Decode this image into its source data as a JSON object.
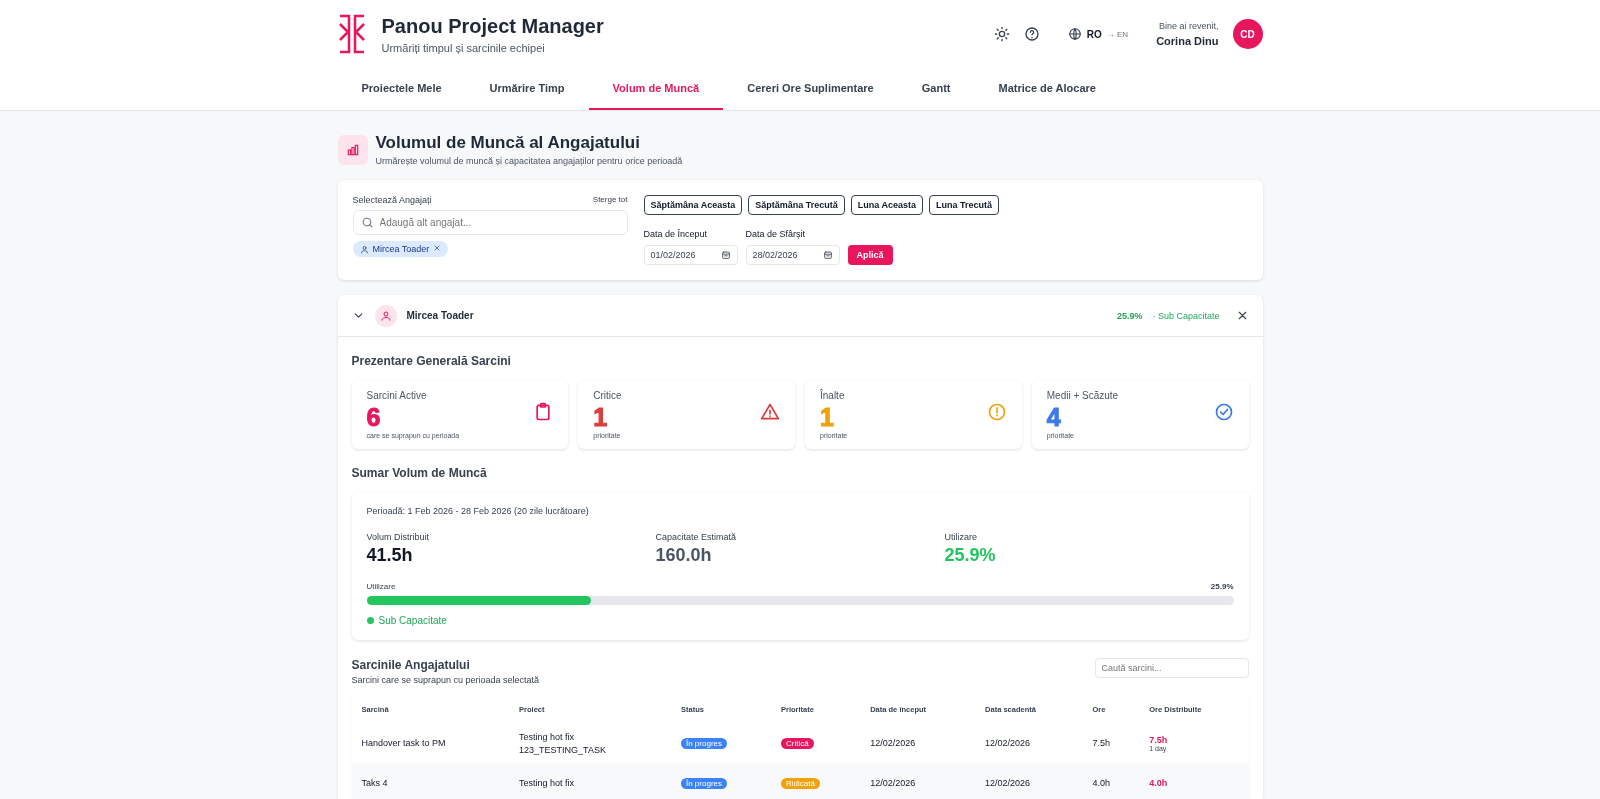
{
  "header": {
    "title": "Panou Project Manager",
    "subtitle": "Urmăriți timpul și sarcinile echipei",
    "languages": [
      {
        "label": "RO",
        "selected": true
      },
      {
        "label": "→ EN",
        "selected": false
      }
    ],
    "welcome": "Bine ai revenit,",
    "user_name": "Corina Dinu",
    "avatar_initials": "CD"
  },
  "tabs": [
    {
      "label": "Proiectele Mele",
      "selected": false
    },
    {
      "label": "Urmărire Timp",
      "selected": false
    },
    {
      "label": "Volum de Muncă",
      "selected": true
    },
    {
      "label": "Cereri Ore Suplimentare",
      "selected": false
    },
    {
      "label": "Gantt",
      "selected": false
    },
    {
      "label": "Matrice de Alocare",
      "selected": false
    }
  ],
  "page": {
    "title": "Volumul de Muncă al Angajatului",
    "subtitle": "Urmărește volumul de muncă și capacitatea angajaților pentru orice perioadă"
  },
  "filters": {
    "employees_label": "Selectează Angajați",
    "clear_all": "Șterge tot",
    "search_placeholder": "Adaugă alt angajat...",
    "chips": [
      "Mircea Toader"
    ],
    "presets": [
      "Săptămâna Aceasta",
      "Săptămâna Trecută",
      "Luna Aceasta",
      "Luna Trecută"
    ],
    "start_label": "Data de Început",
    "start_value": "01/02/2026",
    "end_label": "Data de Sfârșit",
    "end_value": "28/02/2026",
    "apply": "Aplică"
  },
  "employee": {
    "name": "Mircea Toader",
    "expanded": true,
    "percent": "25.9%",
    "status": "· Sub Capacitate",
    "overview_title": "Prezentare Generală Sarcini",
    "stats": [
      {
        "kind": "active",
        "label": "Sarcini Active",
        "value": "6",
        "note": "care se suprapun cu perioada",
        "color": "#e8175d"
      },
      {
        "kind": "critical",
        "label": "Critice",
        "value": "1",
        "note": "prioritate",
        "color": "#dc3b3b"
      },
      {
        "kind": "high",
        "label": "Înalte",
        "value": "1",
        "note": "prioritate",
        "color": "#f0a10b"
      },
      {
        "kind": "low",
        "label": "Medii + Scăzute",
        "value": "4",
        "note": "prioritate",
        "color": "#3b7be8"
      }
    ],
    "summary_title": "Sumar Volum de Muncă",
    "summary": {
      "period": "Perioadă: 1 Feb 2026 - 28 Feb 2026 (20 zile lucrătoare)",
      "metrics": [
        {
          "kind": "plain",
          "label": "Volum Distribuit",
          "value": "41.5h"
        },
        {
          "kind": "muted",
          "label": "Capacitate Estimată",
          "value": "160.0h"
        },
        {
          "kind": "good",
          "label": "Utilizare",
          "value": "25.9%"
        }
      ],
      "bar_label": "Utilizare",
      "bar_value": "25.9%",
      "level": 0.259,
      "legend": "Sub Capacitate"
    },
    "tasks_title": "Sarcinile Angajatului",
    "tasks_subtitle": "Sarcini care se suprapun cu perioada selectată",
    "tasks_search_placeholder": "Caută sarcini...",
    "table": {
      "columns": [
        "Sarcină",
        "Proiect",
        "Status",
        "Prioritate",
        "Data de început",
        "Data scadentă",
        "Ore",
        "Ore Distribuite"
      ],
      "rows": [
        {
          "task": "Handover task to PM",
          "project": "Testing hot fix",
          "project_code": "123_TESTING_TASK",
          "status": "În progres",
          "priority": "Critică",
          "color": "#e8175d",
          "start": "12/02/2026",
          "due": "12/02/2026",
          "hours": "7.5h",
          "distributed": "7.5h",
          "distributed_note": "1 day"
        },
        {
          "task": "Taks 4",
          "project": "Testing hot fix",
          "project_code": "",
          "status": "În progres",
          "priority": "Ridicată",
          "color": "#f0a10b",
          "start": "12/02/2026",
          "due": "12/02/2026",
          "hours": "4.0h",
          "distributed": "4.0h",
          "distributed_note": ""
        }
      ]
    }
  }
}
